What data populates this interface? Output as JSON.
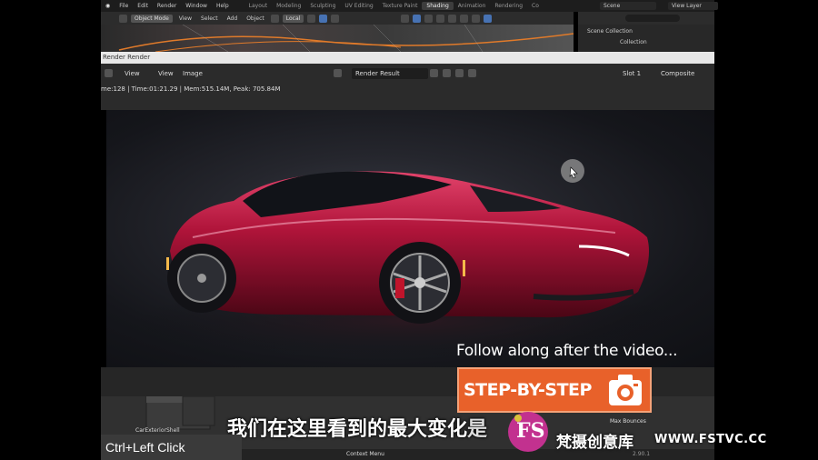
{
  "menubar": {
    "items": [
      "File",
      "Edit",
      "Render",
      "Window",
      "Help"
    ],
    "workspace_tabs": [
      "Layout",
      "Modeling",
      "Sculpting",
      "UV Editing",
      "Texture Paint",
      "Shading",
      "Animation",
      "Rendering",
      "Co"
    ],
    "active_tab": "Shading",
    "scene": "Scene",
    "view_layer": "View Layer"
  },
  "viewport_header": {
    "mode": "Object Mode",
    "menus": [
      "View",
      "Select",
      "Add",
      "Object"
    ],
    "transform_orientation": "Local"
  },
  "outliner": {
    "scene_collection": "Scene Collection",
    "collection": "Collection"
  },
  "render_window": {
    "title": "Render Render",
    "menus": [
      "View",
      "View",
      "Image"
    ],
    "image_name": "Render Result",
    "slot": "Slot 1",
    "pass": "Composite",
    "status": "Time:01:21.29 | Mem:515.14M, Peak: 705.84M",
    "status_prefix": "me:128 | "
  },
  "node_editor": {
    "node_label": "CarExteriorShell",
    "context_menu": "Context Menu",
    "new_bounces": "Max Bounces",
    "version": "2.90.1"
  },
  "overlays": {
    "follow_along": "Follow along after the video...",
    "step_by_step": "STEP-BY-STEP",
    "subtitle": "我们在这里看到的最大变化",
    "subtitle_tail": "是",
    "shortcut": "Ctrl+Left Click",
    "watermark_name": "梵摄创意库",
    "watermark_url": "WWW.FSTVC.CC",
    "watermark_logo": "FS"
  },
  "colors": {
    "accent_orange": "#e8612a",
    "car_red": "#b0143a",
    "blender_blue": "#4772b3"
  }
}
